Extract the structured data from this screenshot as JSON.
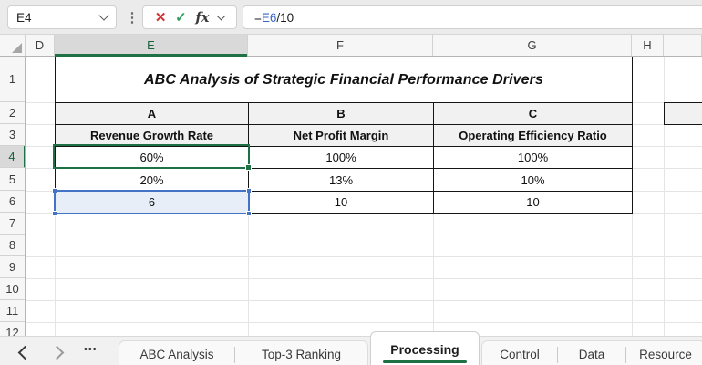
{
  "formula_bar": {
    "name_box_value": "E4",
    "cancel_icon": "✕",
    "enter_icon": "✓",
    "fx_label": "fx",
    "more_icon": "⋮",
    "formula_equals": "=",
    "formula_reference": "E6",
    "formula_remainder": "/10"
  },
  "grid": {
    "columns": [
      "D",
      "E",
      "F",
      "G",
      "H"
    ],
    "rows": [
      "1",
      "2",
      "3",
      "4",
      "5",
      "6",
      "7",
      "8",
      "9",
      "10",
      "11",
      "12"
    ],
    "selected_cell": "E4",
    "referenced_cell": "E6"
  },
  "table": {
    "title": "ABC Analysis of Strategic Financial Performance Drivers",
    "letter_headers": [
      "A",
      "B",
      "C"
    ],
    "name_headers": [
      "Revenue Growth Rate",
      "Net Profit Margin",
      "Operating Efficiency Ratio"
    ],
    "data": [
      [
        "60%",
        "100%",
        "100%"
      ],
      [
        "20%",
        "13%",
        "10%"
      ],
      [
        "6",
        "10",
        "10"
      ]
    ]
  },
  "sheet_tabs": {
    "dots": "•••",
    "tabs": [
      {
        "label": "ABC Analysis"
      },
      {
        "label": "Top-3 Ranking"
      },
      {
        "label": "Processing"
      },
      {
        "label": "Control"
      },
      {
        "label": "Data"
      },
      {
        "label": "Resource"
      }
    ],
    "active_tab": "Processing"
  },
  "colors": {
    "excel_green": "#1e7145",
    "reference_blue": "#4472c4",
    "reference_fill": "#e8eef8",
    "cancel_red": "#d13438",
    "enter_green": "#2e9e5e"
  }
}
